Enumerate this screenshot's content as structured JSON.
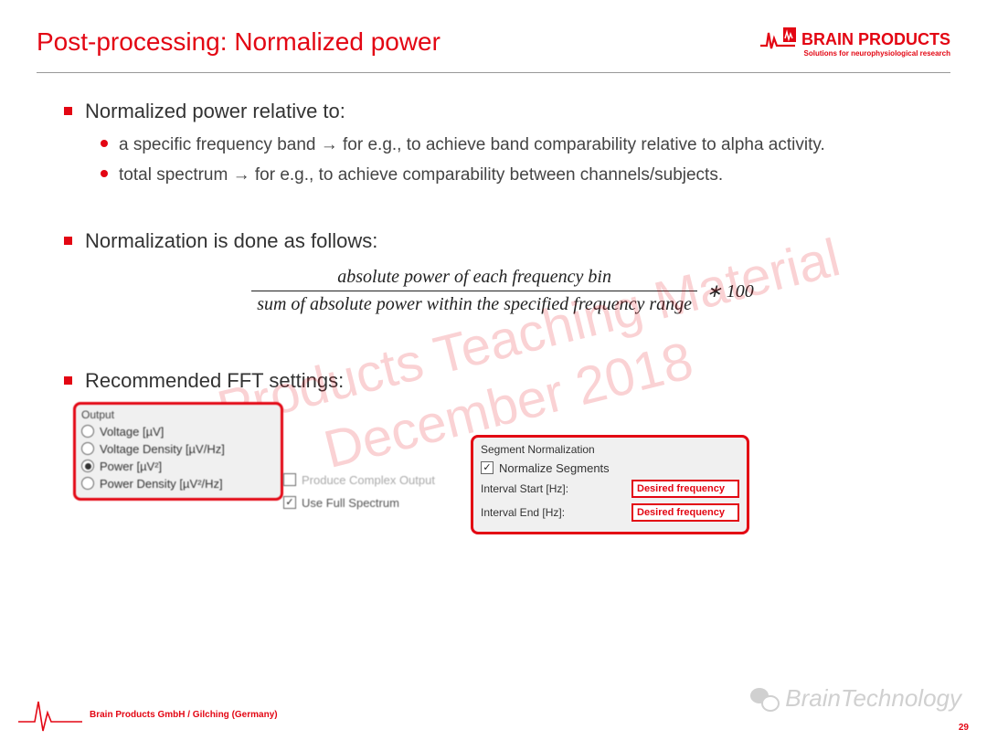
{
  "header": {
    "title": "Post-processing: Normalized power",
    "logo_text": "BRAIN PRODUCTS",
    "logo_sub": "Solutions for neurophysiological research"
  },
  "watermark": {
    "line1": "Brain Products Teaching Material",
    "line2": "December 2018"
  },
  "bullets": {
    "b1": "Normalized power relative to:",
    "b1a": "a specific frequency band → for e.g., to achieve band comparability relative to alpha activity.",
    "b1b": "total spectrum → for e.g., to achieve comparability between channels/subjects.",
    "b2": "Normalization is done as follows:",
    "b3": "Recommended FFT settings:"
  },
  "formula": {
    "numerator": "absolute power of each frequency bin",
    "denominator": "sum of absolute power within the specified frequency range",
    "tail": " ∗ 100"
  },
  "fft": {
    "output_legend": "Output",
    "opt_voltage": "Voltage [µV]",
    "opt_voltage_density": "Voltage Density [µV/Hz]",
    "opt_power": "Power [µV²]",
    "opt_power_density": "Power Density [µV²/Hz]",
    "produce_complex": "Produce Complex Output",
    "use_full_spectrum": "Use Full Spectrum",
    "seg_legend": "Segment Normalization",
    "normalize_segments": "Normalize Segments",
    "interval_start_label": "Interval Start [Hz]:",
    "interval_end_label": "Interval End [Hz]:",
    "desired_frequency": "Desired frequency"
  },
  "footer": {
    "company": "Brain Products GmbH / Gilching (Germany)",
    "page": "29",
    "wechat": "BrainTechnology"
  }
}
